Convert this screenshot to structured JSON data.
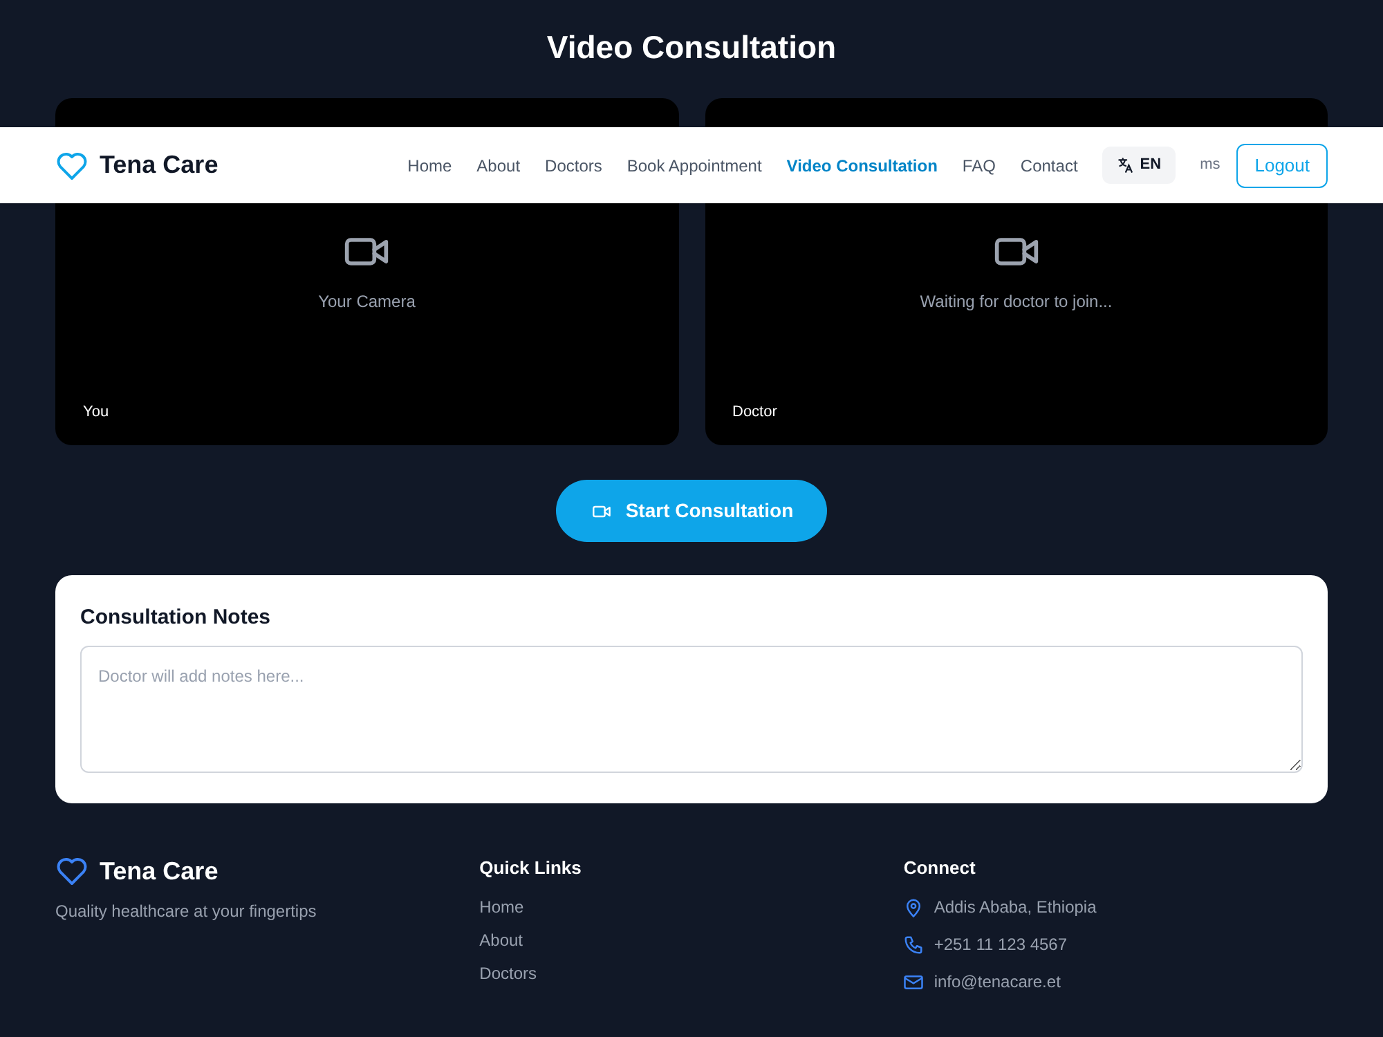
{
  "page_title": "Video Consultation",
  "video_panels": [
    {
      "message": "Your Camera",
      "label": "You"
    },
    {
      "message": "Waiting for doctor to join...",
      "label": "Doctor"
    }
  ],
  "start_button": "Start Consultation",
  "notes": {
    "title": "Consultation Notes",
    "placeholder": "Doctor will add notes here..."
  },
  "navbar": {
    "brand": "Tena Care",
    "links": [
      {
        "label": "Home",
        "selected": false
      },
      {
        "label": "About",
        "selected": false
      },
      {
        "label": "Doctors",
        "selected": false
      },
      {
        "label": "Book Appointment",
        "selected": false
      },
      {
        "label": "Video Consultation",
        "selected": true
      },
      {
        "label": "FAQ",
        "selected": false
      },
      {
        "label": "Contact",
        "selected": false
      }
    ],
    "language": "EN",
    "user": "ms",
    "logout": "Logout"
  },
  "footer": {
    "brand": "Tena Care",
    "tagline": "Quality healthcare at your fingertips",
    "quick_links_title": "Quick Links",
    "quick_links": [
      "Home",
      "About",
      "Doctors"
    ],
    "connect_title": "Connect",
    "contacts": [
      {
        "kind": "location",
        "text": "Addis Ababa, Ethiopia"
      },
      {
        "kind": "phone",
        "text": "+251 11 123 4567"
      },
      {
        "kind": "email",
        "text": "info@tenacare.et"
      }
    ]
  }
}
